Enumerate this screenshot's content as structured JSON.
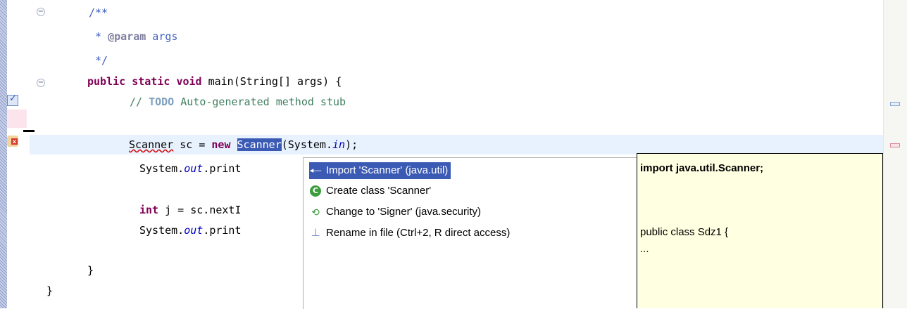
{
  "editor": {
    "lines": {
      "doc_open": "/**",
      "doc_param_star": " * ",
      "doc_param_tag": "@param",
      "doc_param_text": " args",
      "doc_close": " */",
      "main_kw1": "public",
      "main_kw2": "static",
      "main_kw3": "void",
      "main_rest": " main(String[] args) {",
      "todo_prefix": "// ",
      "todo_tag": "TODO",
      "todo_text": " Auto-generated method stub",
      "scanner_type": "Scanner",
      "scanner_mid": " sc = ",
      "scanner_new": "new",
      "scanner_sel": "Scanner",
      "scanner_args": "(System.",
      "scanner_field": "in",
      "scanner_end": ");",
      "print1_a": "System.",
      "print1_field": "out",
      "print1_b": ".print",
      "int_kw": "int",
      "int_rest": " j = sc.nextI",
      "print2_a": "System.",
      "print2_field": "out",
      "print2_b": ".print",
      "close_method": "}",
      "close_class": "}"
    }
  },
  "quick_fix": {
    "items": [
      {
        "label": "Import 'Scanner' (java.util)",
        "icon": "import-icon"
      },
      {
        "label": "Create class 'Scanner'",
        "icon": "class-icon"
      },
      {
        "label": "Change to 'Signer' (java.security)",
        "icon": "change-icon"
      },
      {
        "label": "Rename in file (Ctrl+2, R direct access)",
        "icon": "rename-icon"
      }
    ],
    "selected_index": 0
  },
  "preview": {
    "title": "import java.util.Scanner;",
    "line1": "public class Sdz1 {",
    "line2": "..."
  },
  "colors": {
    "keyword": "#7f0055",
    "comment": "#3f7f5f",
    "javadoc": "#3f5fbf",
    "selection": "#3b5ab4",
    "current_line": "#e8f2fe",
    "info_background": "#ffffe1"
  }
}
